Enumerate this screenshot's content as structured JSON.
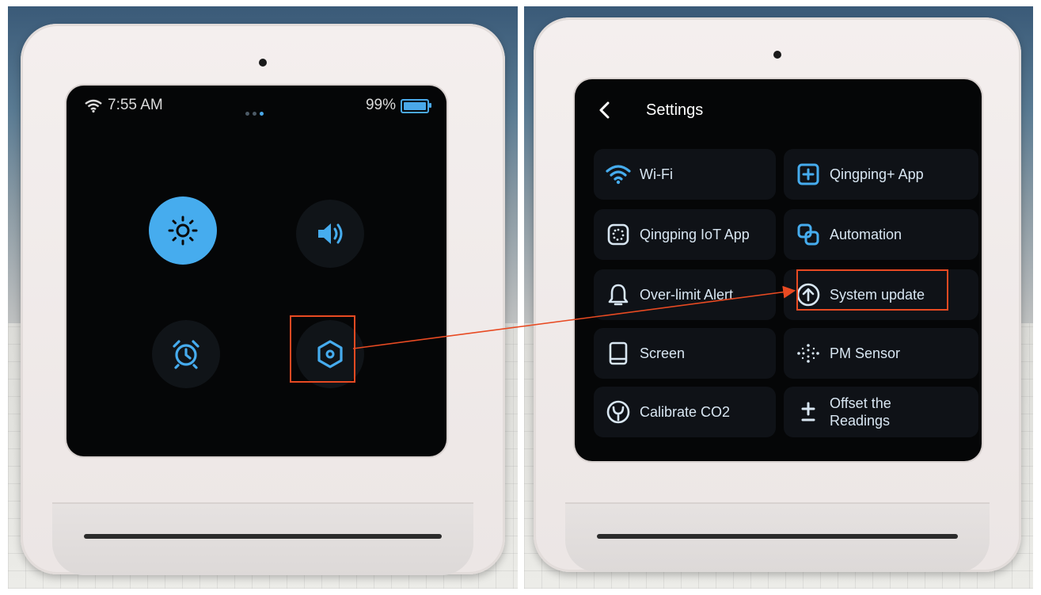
{
  "left_panel": {
    "status": {
      "time": "7:55 AM",
      "battery": "99%",
      "page_dots": 3,
      "active_dot": 3
    },
    "quick_buttons": [
      {
        "name": "brightness",
        "icon": "sun-icon",
        "active": true
      },
      {
        "name": "volume",
        "icon": "speaker-icon",
        "active": false
      },
      {
        "name": "alarm",
        "icon": "alarm-clock-icon",
        "active": false
      },
      {
        "name": "settings",
        "icon": "hexagon-settings-icon",
        "active": false,
        "highlighted": true
      }
    ]
  },
  "right_panel": {
    "header": {
      "back_icon": "chevron-left-icon",
      "title": "Settings"
    },
    "items": [
      {
        "label": "Wi-Fi",
        "icon": "wifi-icon"
      },
      {
        "label": "Qingping+ App",
        "icon": "plus-square-icon"
      },
      {
        "label": "Qingping IoT App",
        "icon": "iot-icon"
      },
      {
        "label": "Automation",
        "icon": "automation-icon"
      },
      {
        "label": "Over-limit Alert",
        "icon": "bell-icon"
      },
      {
        "label": "System update",
        "icon": "upload-circle-icon",
        "highlighted": true
      },
      {
        "label": "Screen",
        "icon": "tablet-icon"
      },
      {
        "label": "PM Sensor",
        "icon": "particles-icon"
      },
      {
        "label": "Calibrate CO2",
        "icon": "calibrate-icon"
      },
      {
        "label": "Offset the Readings",
        "icon": "plus-minus-icon"
      }
    ]
  },
  "colors": {
    "accent": "#46acee",
    "highlight": "#e84a22",
    "screen_bg": "#050607",
    "device_body": "#f0ebea"
  }
}
